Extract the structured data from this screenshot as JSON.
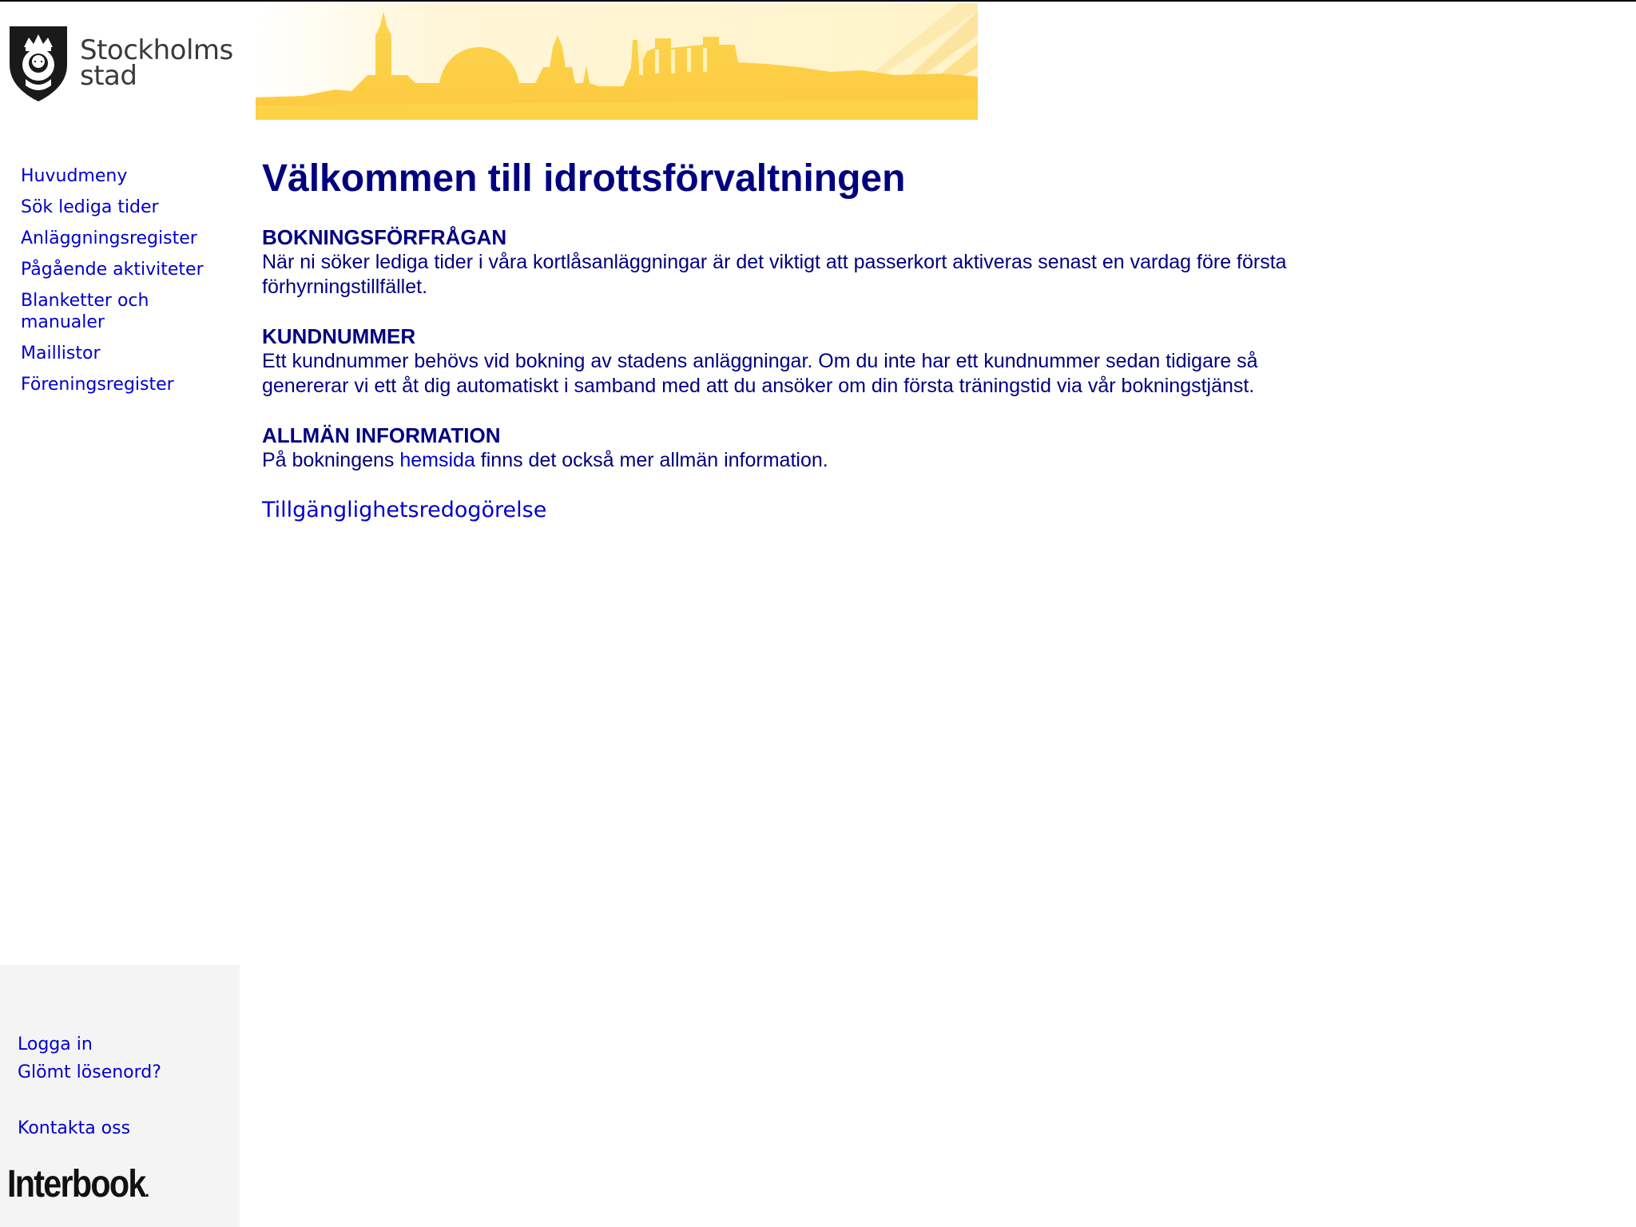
{
  "header": {
    "logo_line1": "Stockholms",
    "logo_line2": "stad",
    "shield_icon": "stockholm-crest-icon",
    "banner_image": "stockholm-skyline-banner"
  },
  "sidebar": {
    "items": [
      {
        "label": "Huvudmeny"
      },
      {
        "label": "Sök lediga tider"
      },
      {
        "label": "Anläggningsregister"
      },
      {
        "label": "Pågående aktiviteter"
      },
      {
        "label": "Blanketter och manualer"
      },
      {
        "label": "Maillistor"
      },
      {
        "label": "Föreningsregister"
      }
    ]
  },
  "main": {
    "title": "Välkommen till idrottsförvaltningen",
    "sections": [
      {
        "heading": "BOKNINGSFÖRFRÅGAN",
        "text": "När ni söker lediga tider i våra kortlåsanläggningar är det viktigt att passerkort aktiveras senast en vardag före första förhyrningstillfället."
      },
      {
        "heading": "KUNDNUMMER",
        "text": "Ett kundnummer behövs vid bokning av stadens anläggningar. Om du inte har ett kundnummer sedan tidigare så genererar vi ett åt dig automatiskt i samband med att du ansöker om din första träningstid via vår bokningstjänst."
      },
      {
        "heading": "ALLMÄN INFORMATION",
        "text_before": "På bokningens ",
        "link": "hemsida",
        "text_after": " finns det också mer allmän information."
      }
    ],
    "accessibility_link": "Tillgänglighetsredogörelse"
  },
  "bottom": {
    "login": "Logga in",
    "forgot_password": "Glömt lösenord?",
    "contact": "Kontakta oss",
    "brand": "Interbook",
    "brand_dot": "."
  },
  "colors": {
    "text": "#000080",
    "link": "#0000cc",
    "banner_yellow": "#fcd651",
    "panel_bg": "#f4f4f4"
  }
}
